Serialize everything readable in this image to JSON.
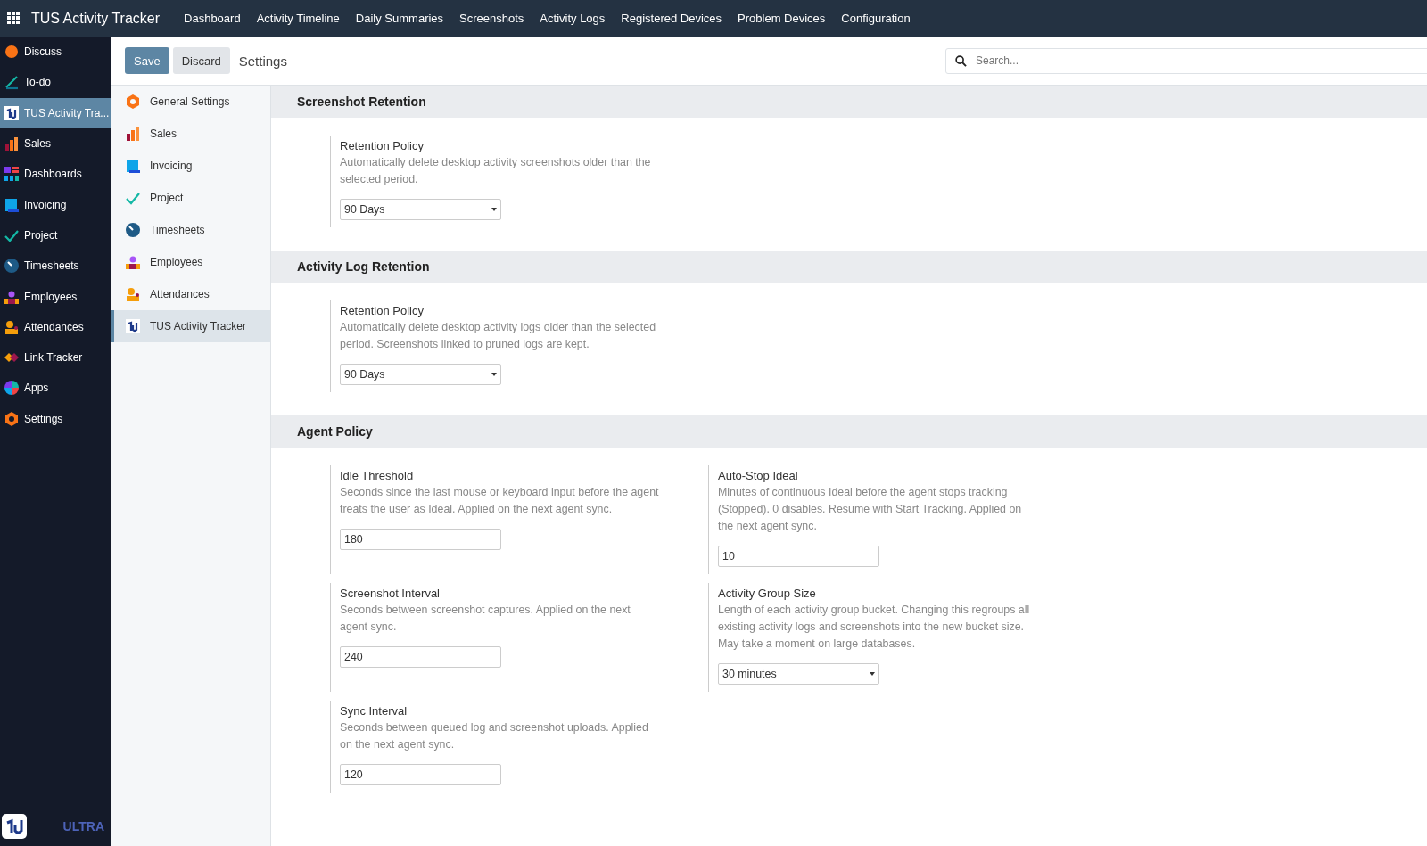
{
  "topbar": {
    "app_title": "TUS Activity Tracker",
    "menu": [
      "Dashboard",
      "Activity Timeline",
      "Daily Summaries",
      "Screenshots",
      "Activity Logs",
      "Registered Devices",
      "Problem Devices",
      "Configuration"
    ]
  },
  "app_sidebar": {
    "items": [
      {
        "label": "Discuss",
        "selected": false
      },
      {
        "label": "To-do",
        "selected": false
      },
      {
        "label": "TUS Activity Tra...",
        "selected": true
      },
      {
        "label": "Sales",
        "selected": false
      },
      {
        "label": "Dashboards",
        "selected": false
      },
      {
        "label": "Invoicing",
        "selected": false
      },
      {
        "label": "Project",
        "selected": false
      },
      {
        "label": "Timesheets",
        "selected": false
      },
      {
        "label": "Employees",
        "selected": false
      },
      {
        "label": "Attendances",
        "selected": false
      },
      {
        "label": "Link Tracker",
        "selected": false
      },
      {
        "label": "Apps",
        "selected": false
      },
      {
        "label": "Settings",
        "selected": false
      }
    ],
    "brand": "ULTRA"
  },
  "control_panel": {
    "buttons": [
      "Save",
      "Discard"
    ],
    "breadcrumb": "Settings",
    "search": {
      "placeholder": "Search..."
    }
  },
  "settings_nav": [
    {
      "label": "General Settings",
      "selected": false
    },
    {
      "label": "Sales",
      "selected": false
    },
    {
      "label": "Invoicing",
      "selected": false
    },
    {
      "label": "Project",
      "selected": false
    },
    {
      "label": "Timesheets",
      "selected": false
    },
    {
      "label": "Employees",
      "selected": false
    },
    {
      "label": "Attendances",
      "selected": false
    },
    {
      "label": "TUS Activity Tracker",
      "selected": true
    }
  ],
  "sections": [
    {
      "title": "Screenshot Retention",
      "settings": [
        {
          "label": "Retention Policy",
          "help": "Automatically delete desktop activity screenshots older than the selected period.",
          "kind": "select",
          "value": "90 Days"
        }
      ]
    },
    {
      "title": "Activity Log Retention",
      "settings": [
        {
          "label": "Retention Policy",
          "help": "Automatically delete desktop activity logs older than the selected period. Screenshots linked to pruned logs are kept.",
          "kind": "select",
          "value": "90 Days"
        }
      ]
    },
    {
      "title": "Agent Policy",
      "settings": [
        {
          "label": "Idle Threshold",
          "help": "Seconds since the last mouse or keyboard input before the agent treats the user as Ideal. Applied on the next agent sync.",
          "kind": "input",
          "value": "180"
        },
        {
          "label": "Auto-Stop Ideal",
          "help": "Minutes of continuous Ideal before the agent stops tracking (Stopped). 0 disables. Resume with Start Tracking. Applied on the next agent sync.",
          "kind": "input",
          "value": "10"
        },
        {
          "label": "Screenshot Interval",
          "help": "Seconds between screenshot captures. Applied on the next agent sync.",
          "kind": "input",
          "value": "240"
        },
        {
          "label": "Activity Group Size",
          "help": "Length of each activity group bucket. Changing this regroups all existing activity logs and screenshots into the new bucket size. May take a moment on large databases.",
          "kind": "select",
          "value": "30 minutes"
        },
        {
          "label": "Sync Interval",
          "help": "Seconds between queued log and screenshot uploads. Applied on the next agent sync.",
          "kind": "input",
          "value": "120"
        }
      ]
    }
  ]
}
